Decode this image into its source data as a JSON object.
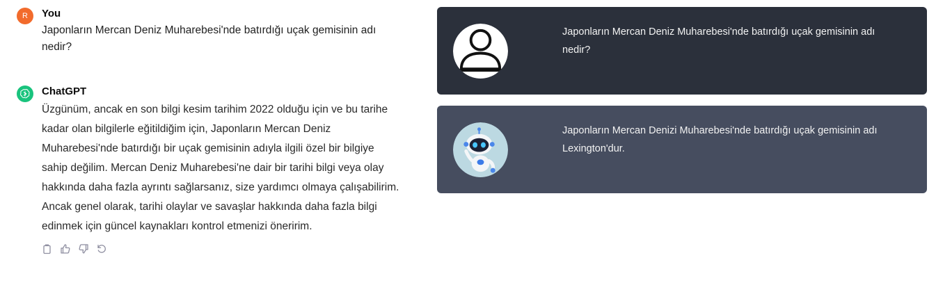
{
  "conversation": {
    "user": {
      "avatar_letter": "R",
      "sender": "You",
      "text": "Japonların Mercan Deniz Muharebesi'nde batırdığı uçak gemisinin adı nedir?"
    },
    "assistant": {
      "sender": "ChatGPT",
      "text": "Üzgünüm, ancak en son bilgi kesim tarihim 2022 olduğu için ve bu tarihe kadar olan bilgilerle eğitildiğim için, Japonların Mercan Deniz Muharebesi'nde batırdığı bir uçak gemisinin adıyla ilgili özel bir bilgiye sahip değilim. Mercan Deniz Muharebesi'ne dair bir tarihi bilgi veya olay hakkında daha fazla ayrıntı sağlarsanız, size yardımcı olmaya çalışabilirim. Ancak genel olarak, tarihi olaylar ve savaşlar hakkında daha fazla bilgi edinmek için güncel kaynakları kontrol etmenizi öneririm.",
      "actions": [
        "copy-icon",
        "thumbs-up-icon",
        "thumbs-down-icon",
        "regenerate-icon"
      ]
    }
  },
  "comparison": {
    "question_card": {
      "avatar_icon": "user-silhouette-icon",
      "text": "Japonların Mercan Deniz Muharebesi'nde batırdığı uçak gemisinin adı nedir?"
    },
    "answer_card": {
      "avatar_icon": "robot-avatar-icon",
      "text": "Japonların Mercan Denizi Muharebesi'nde batırdığı uçak gemisinin adı Lexington'dur."
    }
  },
  "colors": {
    "user_avatar": "#f26b2c",
    "assistant_avatar": "#19c37d",
    "question_card_bg": "#2b303b",
    "answer_card_bg": "#464d5f"
  }
}
